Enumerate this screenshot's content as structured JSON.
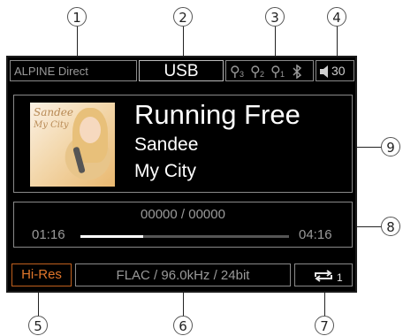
{
  "callouts": {
    "c1": "1",
    "c2": "2",
    "c3": "3",
    "c4": "4",
    "c5": "5",
    "c6": "6",
    "c7": "7",
    "c8": "8",
    "c9": "9"
  },
  "status_bar": {
    "source_name": "ALPINE Direct",
    "source": "USB",
    "usb_ports": [
      "3",
      "2",
      "1"
    ],
    "volume": "30"
  },
  "track": {
    "title": "Running Free",
    "artist": "Sandee",
    "album": "My City",
    "album_art_text_1": "Sandee",
    "album_art_text_2": "My City"
  },
  "progress": {
    "track_counter": "00000 / 00000",
    "elapsed": "01:16",
    "total": "04:16",
    "fraction": 0.3
  },
  "bottom_bar": {
    "hires_badge": "Hi-Res",
    "format": "FLAC / 96.0kHz / 24bit",
    "repeat_mode": "1"
  },
  "colors": {
    "hires": "#e0762a"
  }
}
